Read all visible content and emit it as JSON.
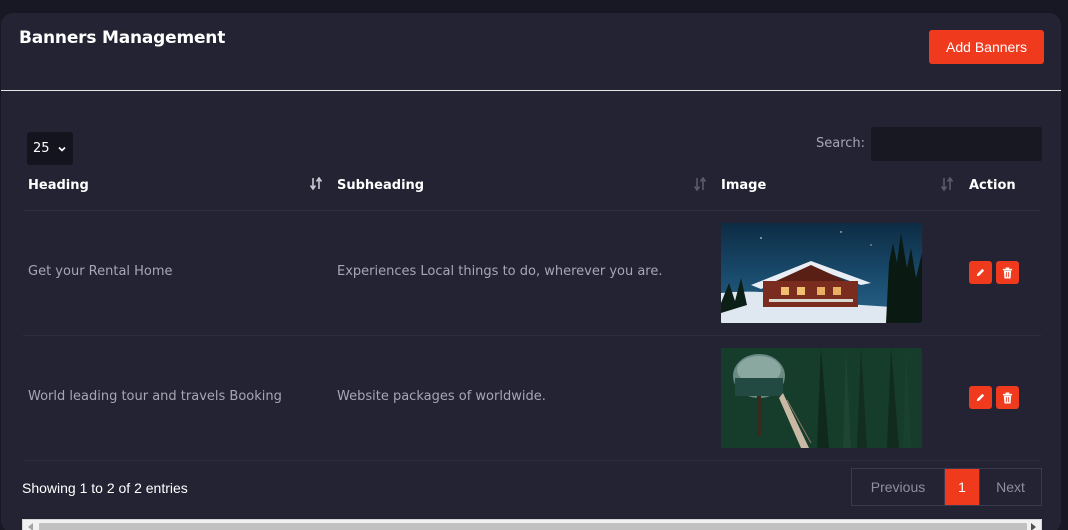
{
  "page": {
    "title": "Banners Management",
    "add_button": "Add Banners"
  },
  "controls": {
    "page_length": "25",
    "search_label": "Search:",
    "search_value": ""
  },
  "table": {
    "headers": [
      "Heading",
      "Subheading",
      "Image",
      "Action"
    ],
    "rows": [
      {
        "heading": "Get your Rental Home",
        "subheading": "Experiences Local things to do, wherever you are.",
        "image": "snowy-cabin-night-photo"
      },
      {
        "heading": "World leading tour and travels Booking",
        "subheading": "Website packages of worldwide.",
        "image": "forest-treehouse-pod-photo"
      }
    ]
  },
  "footer": {
    "info": "Showing 1 to 2 of 2 entries",
    "previous": "Previous",
    "current_page": "1",
    "next": "Next"
  },
  "colors": {
    "accent": "#ef3a1e",
    "card": "#232333",
    "background": "#181824"
  }
}
